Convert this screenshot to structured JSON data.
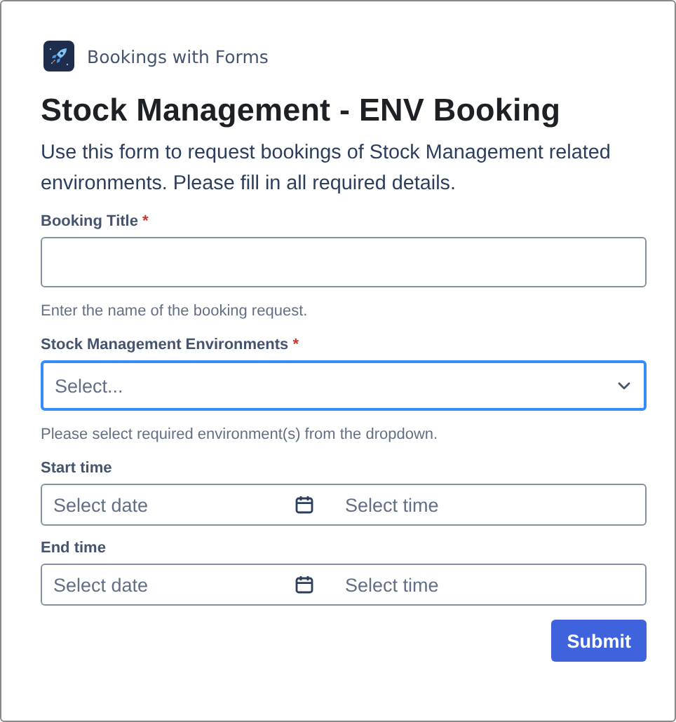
{
  "app": {
    "name": "Bookings with Forms"
  },
  "form": {
    "title": "Stock Management - ENV Booking",
    "description": "Use this form to request bookings of Stock Management related environments. Please fill in all required details.",
    "fields": [
      {
        "kind": "text",
        "label": "Booking Title",
        "required_mark": "*",
        "focused": false,
        "helper": "Enter the name of the booking request."
      },
      {
        "kind": "select",
        "label": "Stock Management Environments",
        "required_mark": "*",
        "focused": true,
        "placeholder": "Select...",
        "helper": "Please select required environment(s) from the dropdown."
      },
      {
        "kind": "datetime",
        "label": "Start time",
        "focused": false,
        "date_placeholder": "Select date",
        "time_placeholder": "Select time"
      },
      {
        "kind": "datetime",
        "label": "End time",
        "focused": false,
        "date_placeholder": "Select date",
        "time_placeholder": "Select time"
      }
    ],
    "submit": "Submit"
  }
}
